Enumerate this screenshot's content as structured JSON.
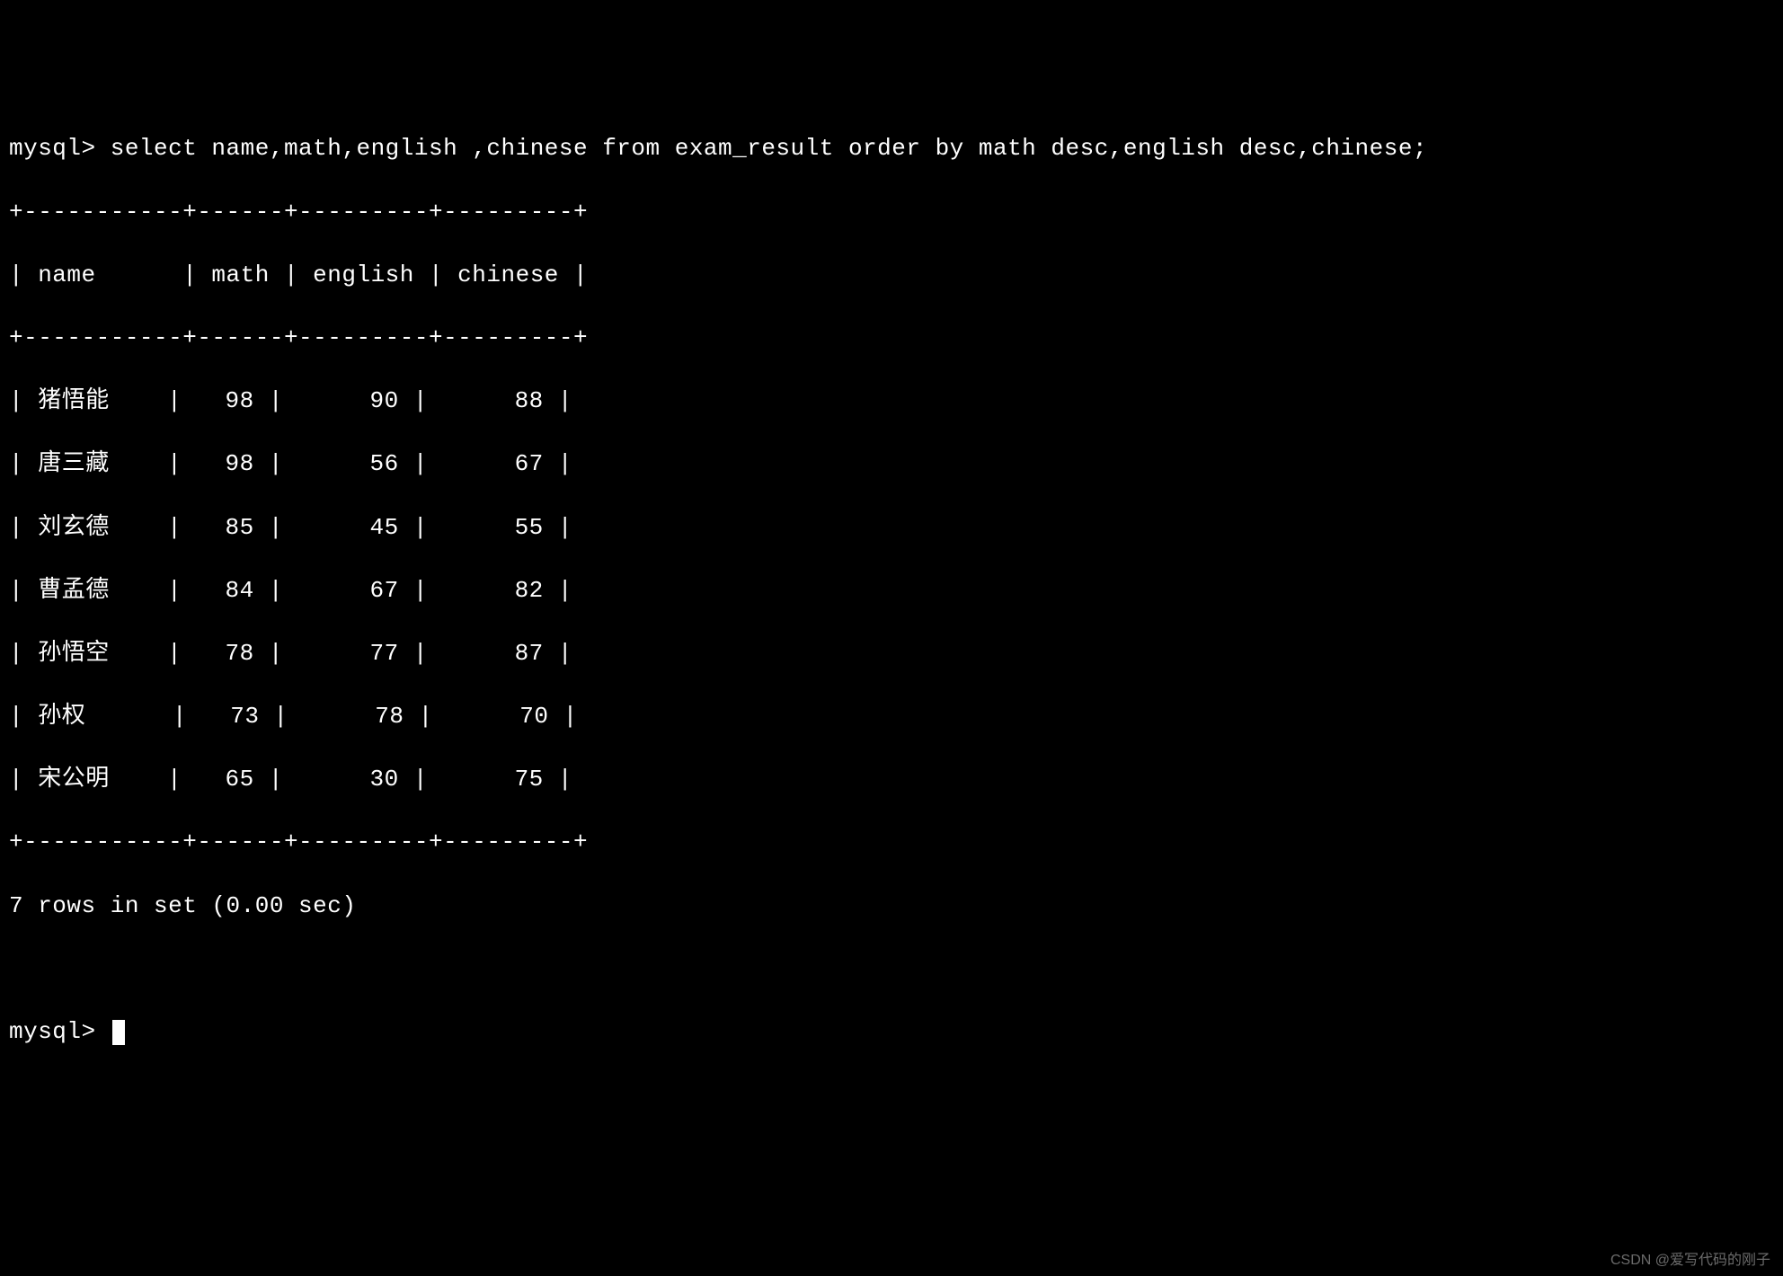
{
  "prompt": "mysql> ",
  "query": "select name,math,english ,chinese from exam_result order by math desc,english desc,chinese;",
  "table": {
    "border_top": "+-----------+------+---------+---------+",
    "header": "| name      | math | english | chinese |",
    "border_mid": "+-----------+------+---------+---------+",
    "rows": [
      "| 猪悟能    |   98 |      90 |      88 |",
      "| 唐三藏    |   98 |      56 |      67 |",
      "| 刘玄德    |   85 |      45 |      55 |",
      "| 曹孟德    |   84 |      67 |      82 |",
      "| 孙悟空    |   78 |      77 |      87 |",
      "| 孙权      |   73 |      78 |      70 |",
      "| 宋公明    |   65 |      30 |      75 |"
    ],
    "border_bottom": "+-----------+------+---------+---------+"
  },
  "result_summary": "7 rows in set (0.00 sec)",
  "prompt2": "mysql> ",
  "watermark": "CSDN @爱写代码的刚子",
  "chart_data": {
    "type": "table",
    "columns": [
      "name",
      "math",
      "english",
      "chinese"
    ],
    "rows": [
      {
        "name": "猪悟能",
        "math": 98,
        "english": 90,
        "chinese": 88
      },
      {
        "name": "唐三藏",
        "math": 98,
        "english": 56,
        "chinese": 67
      },
      {
        "name": "刘玄德",
        "math": 85,
        "english": 45,
        "chinese": 55
      },
      {
        "name": "曹孟德",
        "math": 84,
        "english": 67,
        "chinese": 82
      },
      {
        "name": "孙悟空",
        "math": 78,
        "english": 77,
        "chinese": 87
      },
      {
        "name": "孙权",
        "math": 73,
        "english": 78,
        "chinese": 70
      },
      {
        "name": "宋公明",
        "math": 65,
        "english": 30,
        "chinese": 75
      }
    ]
  }
}
